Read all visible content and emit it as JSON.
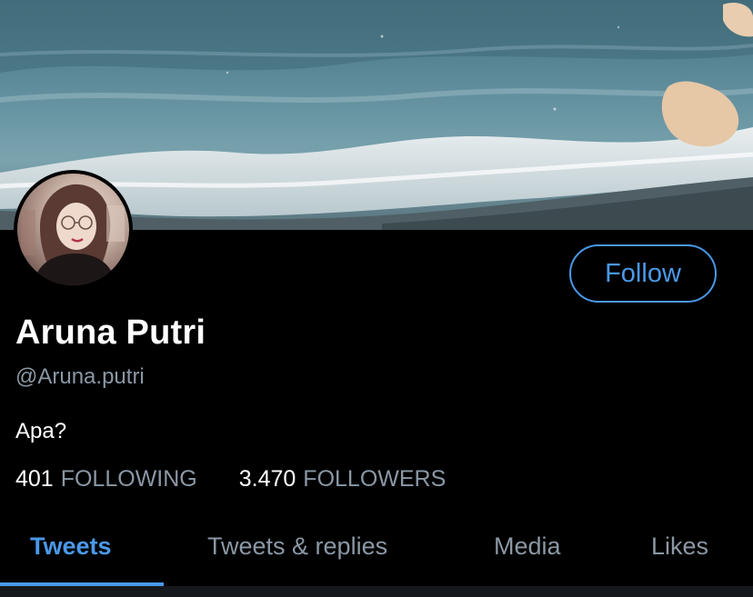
{
  "profile": {
    "display_name": "Aruna Putri",
    "handle": "@Aruna.putri",
    "bio": "Apa?",
    "following_count": "401",
    "following_label": "FOLLOWING",
    "followers_count": "3.470",
    "followers_label": "FOLLOWERS"
  },
  "actions": {
    "follow_label": "Follow"
  },
  "tabs": [
    {
      "label": "Tweets",
      "active": true
    },
    {
      "label": "Tweets & replies",
      "active": false
    },
    {
      "label": "Media",
      "active": false
    },
    {
      "label": "Likes",
      "active": false
    }
  ],
  "colors": {
    "background": "#000000",
    "accent": "#4a99e9",
    "secondary_text": "#8b98a5",
    "primary_text": "#ffffff"
  }
}
